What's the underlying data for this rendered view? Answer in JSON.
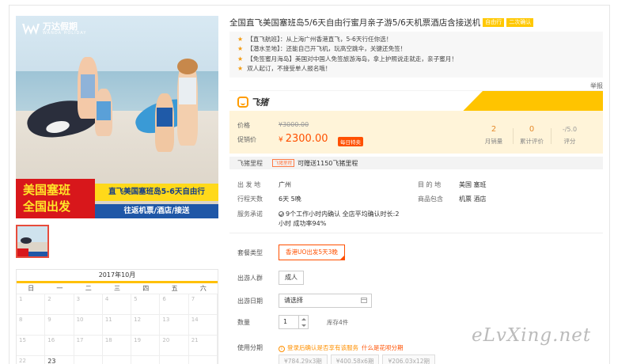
{
  "hero": {
    "logo_text": "万达假期",
    "logo_sub": "WANDA HOLIDAY",
    "banner_red_line1": "美国塞班",
    "banner_red_line2": "全国出发",
    "banner_yellow": "直飞美国塞班岛5-6天自由行",
    "banner_blue": "往返机票/酒店/接送"
  },
  "calendar": {
    "month": "2017年10月",
    "weekdays": [
      "日",
      "一",
      "二",
      "三",
      "四",
      "五",
      "六"
    ],
    "rows": [
      [
        "1",
        "2",
        "3",
        "4",
        "5",
        "6",
        "7"
      ],
      [
        "8",
        "9",
        "10",
        "11",
        "12",
        "13",
        "14"
      ],
      [
        "15",
        "16",
        "17",
        "18",
        "19",
        "20",
        "21"
      ],
      [
        "22",
        "23",
        "",
        "",
        "",
        "",
        ""
      ]
    ]
  },
  "product": {
    "title": "全国直飞美国塞班岛5/6天自由行蜜月亲子游5/6天机票酒店含接送机",
    "tag1": "自由行",
    "tag2": "二次确认",
    "highlights": [
      "【直飞航班】：从上海广州香港直飞，5-6天行任你选！",
      "【潜水圣地】：还能自己开飞机，玩高空跳伞，关键还免签！",
      "【免签蜜月海岛】美国对中国人免签旅游海岛，拿上护照说走就走，亲子蜜月！",
      "双人起订，不接受单人报名哦！"
    ],
    "report": "举报"
  },
  "brand": {
    "name": "飞猪"
  },
  "price": {
    "label_price": "价格",
    "old_price": "¥3000.00",
    "label_promo": "促销价",
    "currency": "¥",
    "current": "2300.00",
    "sale_tag": "每日特卖",
    "monthly_sales_value": "2",
    "monthly_sales_label": "月销量",
    "reviews_value": "0",
    "reviews_label": "累计评价",
    "rating_value": "-/5.0",
    "rating_label": "评分"
  },
  "miles": {
    "label": "飞猪里程",
    "tag": "飞猪里程",
    "text": "可赠送1150飞猪里程"
  },
  "info": {
    "depart_label": "出 发 地",
    "depart_value": "广州",
    "dest_label": "目 的 地",
    "dest_value": "美国  塞班",
    "days_label": "行程天数",
    "days_value": "6天  5晚",
    "includes_label": "商品包含",
    "includes_value": "机票  酒店",
    "promise_label": "服务承诺",
    "promise_line1": "9个工作小时内确认 全店平均确认时长:2",
    "promise_line2": "小时 成功率94%"
  },
  "options": {
    "package_label": "套餐类型",
    "package_value": "香港UO出发5天3晚",
    "group_label": "出游人群",
    "group_value": "成人",
    "date_label": "出游日期",
    "date_placeholder": "请选择",
    "qty_label": "数量",
    "qty_value": "1",
    "stock": "库存4件",
    "installment_label": "使用分期",
    "installment_note": "登录后确认是否享有该服务",
    "installment_link": "什么是花呗分期",
    "installments": [
      "¥784.29x3期",
      "¥400.58x6期",
      "¥206.03x12期"
    ]
  },
  "watermark": "eLvXing.net"
}
